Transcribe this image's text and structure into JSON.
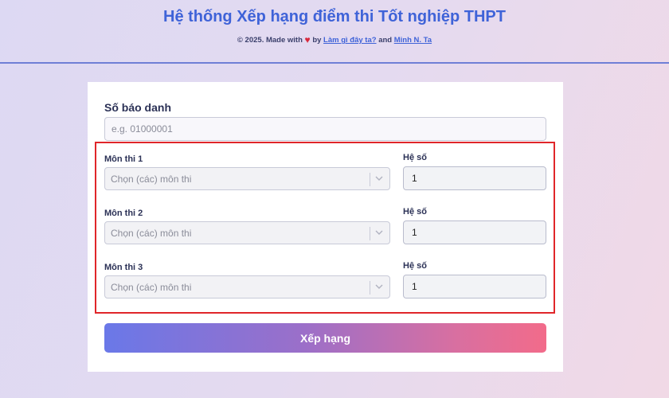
{
  "header": {
    "title": "Hệ thống Xếp hạng điểm thi Tốt nghiệp THPT",
    "credit_prefix": "© 2025. Made with",
    "heart": "♥",
    "credit_by": "by",
    "link1": "Làm gì đây ta?",
    "credit_and": "and",
    "link2": "Minh N. Ta"
  },
  "form": {
    "sbd_label": "Số báo danh",
    "sbd_placeholder": "e.g. 01000001",
    "subjects": [
      {
        "label": "Môn thi 1",
        "placeholder": "Chọn (các) môn thi",
        "coef_label": "Hệ số",
        "coef_value": "1"
      },
      {
        "label": "Môn thi 2",
        "placeholder": "Chọn (các) môn thi",
        "coef_label": "Hệ số",
        "coef_value": "1"
      },
      {
        "label": "Môn thi 3",
        "placeholder": "Chọn (các) môn thi",
        "coef_label": "Hệ số",
        "coef_value": "1"
      }
    ],
    "submit_label": "Xếp hạng"
  },
  "colors": {
    "title": "#3f63d8",
    "highlight_border": "#e0262a",
    "button_gradient_start": "#6a78e8",
    "button_gradient_end": "#f26b8a"
  }
}
